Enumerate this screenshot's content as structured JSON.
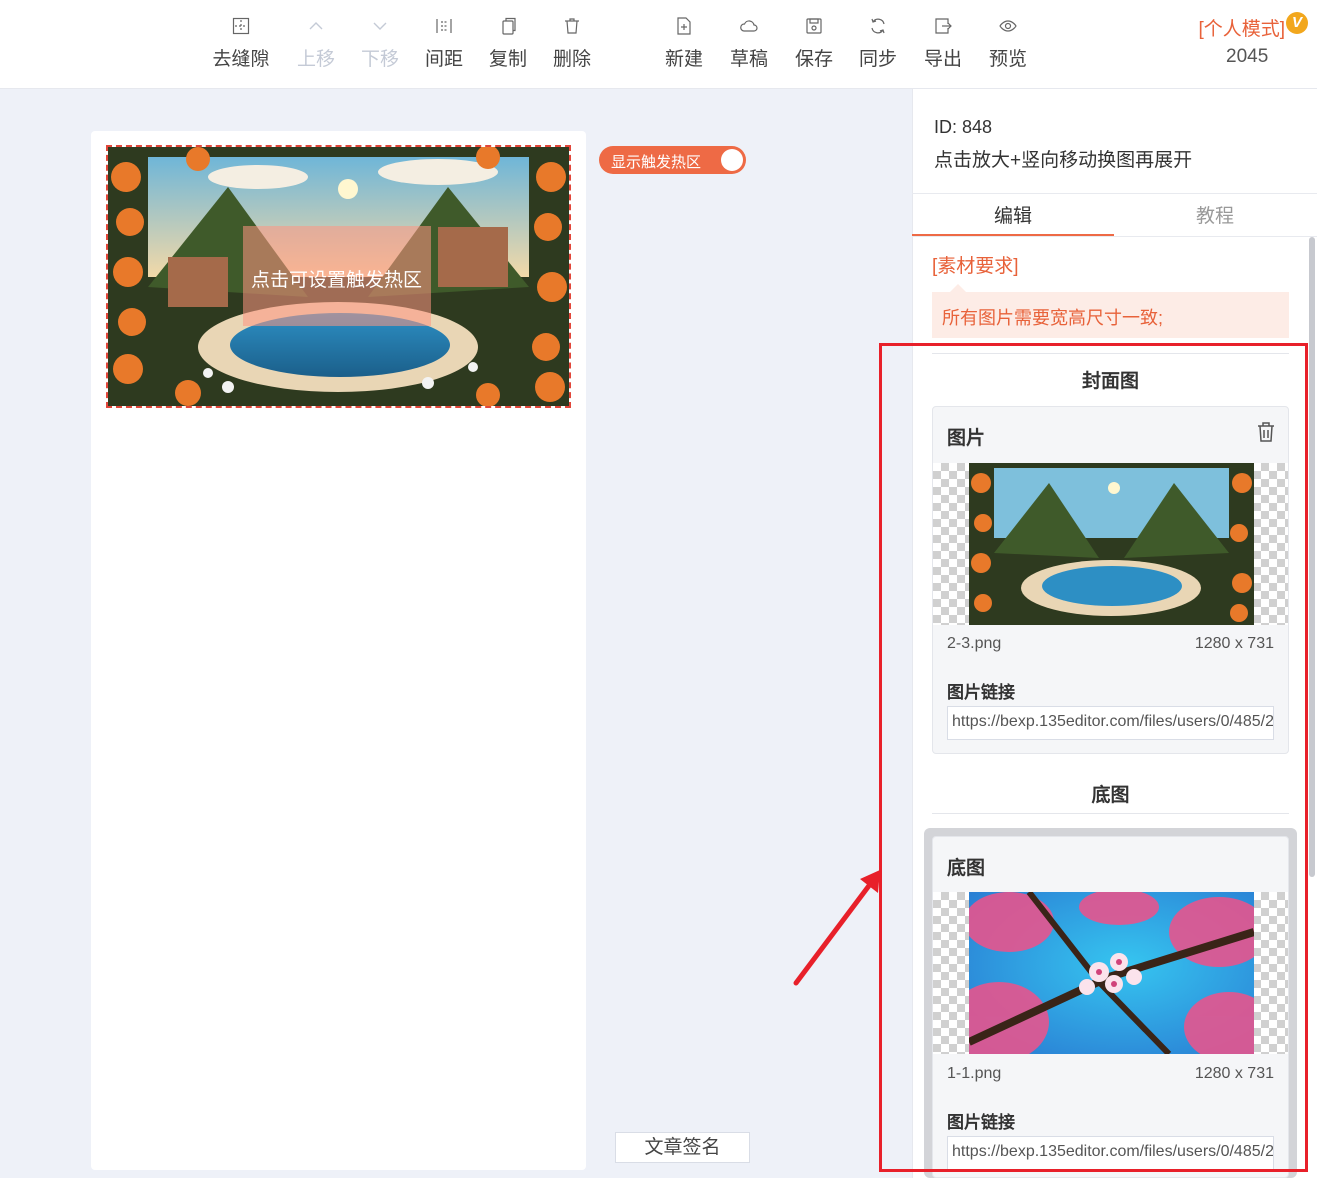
{
  "toolbar": {
    "items": [
      {
        "label": "去缝隙",
        "icon": "dashed-grid-icon",
        "enabled": true
      },
      {
        "label": "上移",
        "icon": "chevron-up-icon",
        "enabled": false
      },
      {
        "label": "下移",
        "icon": "chevron-down-icon",
        "enabled": false
      },
      {
        "label": "间距",
        "icon": "spacing-icon",
        "enabled": true
      },
      {
        "label": "复制",
        "icon": "copy-icon",
        "enabled": true
      },
      {
        "label": "删除",
        "icon": "trash-icon",
        "enabled": true
      },
      {
        "label": "新建",
        "icon": "new-file-icon",
        "enabled": true
      },
      {
        "label": "草稿",
        "icon": "cloud-icon",
        "enabled": true
      },
      {
        "label": "保存",
        "icon": "save-icon",
        "enabled": true
      },
      {
        "label": "同步",
        "icon": "sync-icon",
        "enabled": true
      },
      {
        "label": "导出",
        "icon": "export-icon",
        "enabled": true
      },
      {
        "label": "预览",
        "icon": "eye-icon",
        "enabled": true
      }
    ],
    "mode_label": "[个人模式]",
    "vip_badge": "V",
    "count": "2045"
  },
  "canvas": {
    "hotzone_label": "点击可设置触发热区",
    "toggle_label": "显示触发热区",
    "toggle_on": true,
    "signature_button": "文章签名"
  },
  "panel": {
    "id_text": "ID: 848",
    "description": "点击放大+竖向移动换图再展开",
    "tabs": [
      {
        "label": "编辑",
        "active": true
      },
      {
        "label": "教程",
        "active": false
      }
    ],
    "requirement_title": "[素材要求]",
    "requirement_text": "所有图片需要宽高尺寸一致;",
    "cover": {
      "section_title": "封面图",
      "card_title": "图片",
      "filename": "2-3.png",
      "dimensions": "1280 x 731",
      "link_label": "图片链接",
      "link_value": "https://bexp.135editor.com/files/users/0/485/2"
    },
    "base": {
      "section_title": "底图",
      "card_title": "底图",
      "filename": "1-1.png",
      "dimensions": "1280 x 731",
      "link_label": "图片链接",
      "link_value": "https://bexp.135editor.com/files/users/0/485/2"
    }
  },
  "colors": {
    "accent": "#ee6a45",
    "highlight": "#e8202a",
    "background": "#eef1f8"
  }
}
